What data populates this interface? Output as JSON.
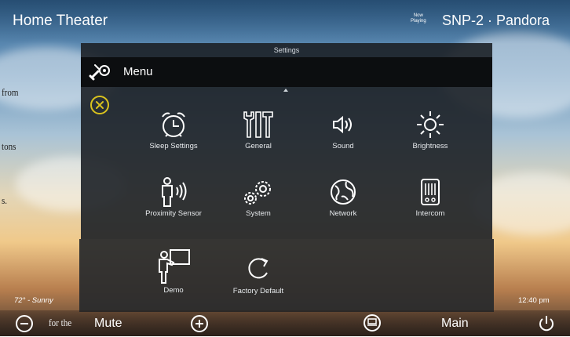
{
  "header": {
    "title": "Home Theater",
    "now_playing_line1": "Now",
    "now_playing_line2": "Playing",
    "source": "SNP-2 · Pandora"
  },
  "edge_text": [
    "from",
    "tons",
    "s.",
    "for the"
  ],
  "dialog": {
    "title": "Settings",
    "menu_label": "Menu"
  },
  "tiles": [
    {
      "label": "Sleep Settings",
      "icon": "alarm-clock-icon"
    },
    {
      "label": "General",
      "icon": "tools-icon"
    },
    {
      "label": "Sound",
      "icon": "speaker-icon"
    },
    {
      "label": "Brightness",
      "icon": "sun-icon"
    },
    {
      "label": "Proximity Sensor",
      "icon": "proximity-icon"
    },
    {
      "label": "System",
      "icon": "gears-icon"
    },
    {
      "label": "Network",
      "icon": "globe-icon"
    },
    {
      "label": "Intercom",
      "icon": "intercom-icon"
    },
    {
      "label": "Demo",
      "icon": "presenter-icon"
    },
    {
      "label": "Factory Default",
      "icon": "reset-icon"
    }
  ],
  "status": {
    "weather": "72° - Sunny",
    "time": "12:40 pm"
  },
  "bottom_bar": {
    "mute_label": "Mute",
    "main_label": "Main"
  }
}
